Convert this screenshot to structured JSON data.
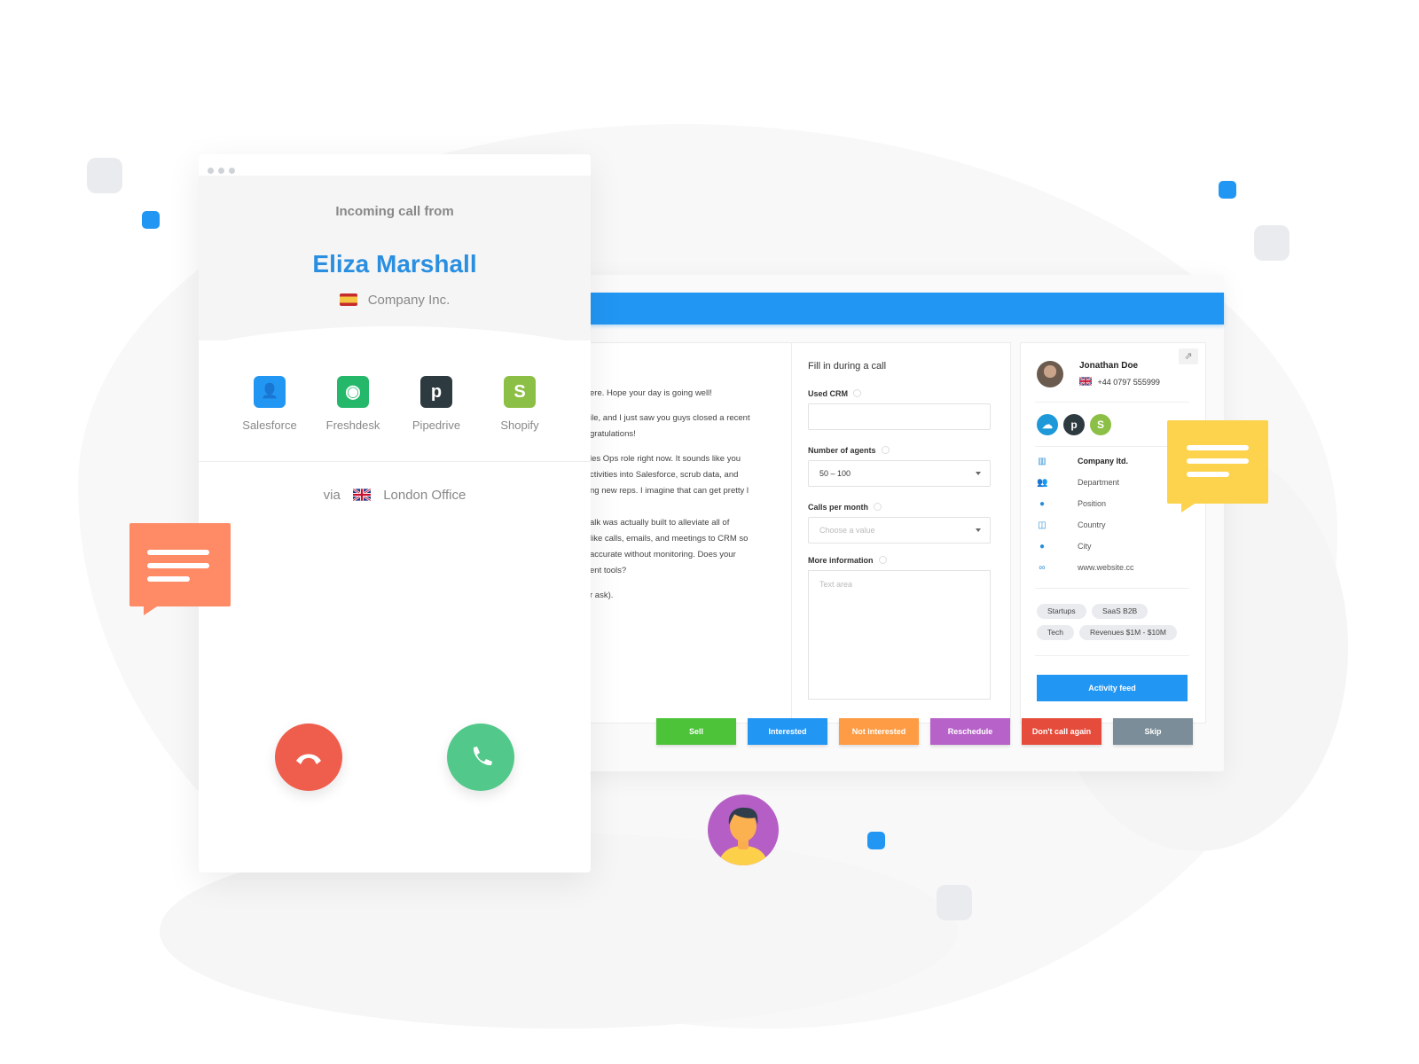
{
  "colors": {
    "brand_blue": "#2196f3",
    "caller_name": "#2a8fe0",
    "decline": "#ef5d4c",
    "accept": "#52c98a",
    "bubble_orange": "#fe8a66",
    "bubble_yellow": "#fdd34d"
  },
  "phone": {
    "window_dots": 3,
    "incoming_label": "Incoming call from",
    "caller_name": "Eliza Marshall",
    "caller_company": "Company Inc.",
    "caller_flag": "spain-flag-icon",
    "integrations": [
      {
        "label": "Salesforce",
        "icon": "salesforce-icon",
        "color": "#2196f3"
      },
      {
        "label": "Freshdesk",
        "icon": "freshdesk-icon",
        "color": "#25b86b"
      },
      {
        "label": "Pipedrive",
        "icon": "pipedrive-icon",
        "color": "#2d3a40"
      },
      {
        "label": "Shopify",
        "icon": "shopify-icon",
        "color": "#8cbf45"
      }
    ],
    "via_label": "via",
    "via_flag": "uk-flag-icon",
    "via_office": "London Office",
    "decline_icon": "hang-up-icon",
    "accept_icon": "phone-icon"
  },
  "crm": {
    "script_lines": [
      "ere. Hope your day is going well!",
      "ile, and I just saw you guys closed a recent",
      "gratulations!",
      "les Ops role right now. It sounds like you",
      "ctivities into Salesforce, scrub data, and",
      "ng new reps. I imagine that can get pretty l",
      "alk was actually built to alleviate all of",
      "like calls, emails, and meetings to CRM so",
      "accurate without monitoring. Does your",
      "ent tools?",
      "r ask)."
    ],
    "form": {
      "title": "Fill in during a call",
      "used_crm_label": "Used CRM",
      "used_crm_value": "",
      "agents_label": "Number of agents",
      "agents_value": "50 – 100",
      "calls_label": "Calls per month",
      "calls_placeholder": "Choose a value",
      "more_info_label": "More information",
      "more_info_placeholder": "Text area"
    },
    "contact": {
      "name": "Jonathan Doe",
      "phone": "+44 0797 555999",
      "integrations": [
        {
          "icon": "salesforce-icon",
          "color": "#1d98d8",
          "glyph": "☁"
        },
        {
          "icon": "pipedrive-icon",
          "color": "#2d3a40",
          "glyph": "p"
        },
        {
          "icon": "shopify-icon",
          "color": "#8cbf45",
          "glyph": "S"
        }
      ],
      "info": [
        {
          "icon": "building-icon",
          "glyph": "▥",
          "text": "Company ltd."
        },
        {
          "icon": "group-icon",
          "glyph": "👥",
          "text": "Department"
        },
        {
          "icon": "person-icon",
          "glyph": "●",
          "text": "Position"
        },
        {
          "icon": "map-icon",
          "glyph": "◫",
          "text": "Country"
        },
        {
          "icon": "location-pin-icon",
          "glyph": "●",
          "text": "City"
        },
        {
          "icon": "link-icon",
          "glyph": "∞",
          "text": "www.website.cc"
        }
      ],
      "tags": [
        "Startups",
        "SaaS B2B",
        "Tech",
        "Revenues $1M - $10M"
      ],
      "activity_button": "Activity feed"
    },
    "outcomes": [
      {
        "label": "Sell",
        "color": "#4dc33a"
      },
      {
        "label": "Interested",
        "color": "#2196f3"
      },
      {
        "label": "Not interested",
        "color": "#fd9c45"
      },
      {
        "label": "Reschedule",
        "color": "#b662c8"
      },
      {
        "label": "Don't call again",
        "color": "#e64c3c"
      },
      {
        "label": "Skip",
        "color": "#7b8d98"
      }
    ]
  }
}
